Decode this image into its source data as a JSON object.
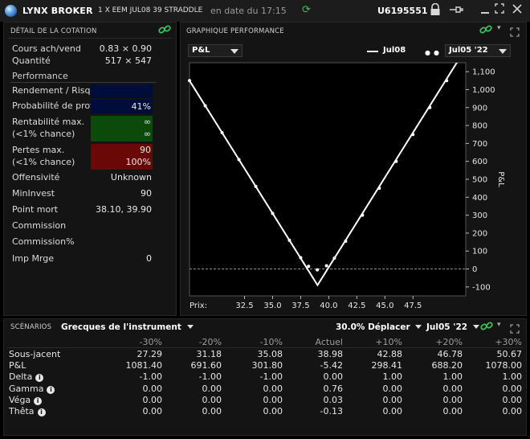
{
  "titlebar": {
    "app_title": "LYNX BROKER",
    "subtitle": "1 X EEM JUL08 39 STRADDLE",
    "date_label": "en date du 17:15",
    "account_id": "U6195551"
  },
  "quote": {
    "title": "DÉTAIL DE LA COTATION",
    "rows": {
      "bidask": {
        "label": "Cours ach/vend",
        "value": "0.83 × 0.90"
      },
      "qty": {
        "label": "Quantité",
        "value": "517 × 547"
      },
      "perf_header": "Performance",
      "rr": {
        "label": "Rendement / Risque",
        "value": ""
      },
      "prob": {
        "label": "Probabilité de profits",
        "value": "41%"
      },
      "maxret": {
        "label1": "Rentabilité max.",
        "label2": "(<1% chance)",
        "value1": "∞",
        "value2": "∞"
      },
      "maxloss": {
        "label1": "Pertes max.",
        "label2": "(<1% chance)",
        "value1": "90",
        "value2": "100%"
      },
      "offens": {
        "label": "Offensivité",
        "value": "Unknown"
      },
      "mininv": {
        "label": "MinInvest",
        "value": "90"
      },
      "breakeven": {
        "label": "Point mort",
        "value": "38.10, 39.90"
      },
      "commission": {
        "label": "Commission",
        "value": ""
      },
      "commissionpct": {
        "label": "Commission%",
        "value": ""
      },
      "impmrge": {
        "label": "Imp Mrge",
        "value": "0"
      }
    }
  },
  "perf_chart": {
    "title": "GRAPHIQUE PERFORMANCE",
    "pl_select": "P&L",
    "legend_solid": "Jul08",
    "legend_dotted": "Jul05 '22",
    "date_select": "Jul05 '22"
  },
  "chart_data": {
    "type": "line",
    "xlabel": "Prix:",
    "ylabel": "P&L",
    "xlim": [
      27.6,
      52.2
    ],
    "ylim": [
      -150,
      1150
    ],
    "x_ticks": [
      "32.5",
      "35.0",
      "37.5",
      "40.0",
      "42.5",
      "45.0",
      "47.5"
    ],
    "y_ticks": [
      "1,100",
      "1,000",
      "900",
      "800",
      "700",
      "600",
      "500",
      "400",
      "300",
      "200",
      "100",
      "0",
      "-100"
    ],
    "series": [
      {
        "name": "Jul08",
        "style": "solid",
        "x": [
          27.6,
          39.0,
          52.2
        ],
        "y": [
          1050,
          -90,
          1230
        ]
      },
      {
        "name": "Jul05 '22",
        "style": "dotted",
        "x": [
          27.6,
          29.0,
          30.5,
          32.0,
          33.5,
          35.0,
          36.5,
          37.5,
          38.2,
          38.98,
          39.8,
          40.5,
          41.5,
          43.0,
          44.5,
          46.0,
          47.5,
          49.0,
          50.5,
          52.2
        ],
        "y": [
          1050,
          910,
          760,
          610,
          460,
          310,
          160,
          63,
          15,
          -5,
          18,
          60,
          155,
          300,
          450,
          600,
          750,
          900,
          1050,
          1220
        ]
      }
    ],
    "zero_line": true,
    "grid": false
  },
  "scenarios": {
    "title": "SCÉNARIOS",
    "greeks_select": "Grecques de l'instrument",
    "shift_select": "30.0% Déplacer",
    "date_select": "Jul05 '22",
    "columns": [
      "-30%",
      "-20%",
      "-10%",
      "Actuel",
      "+10%",
      "+20%",
      "+30%"
    ],
    "rows": [
      {
        "label": "Sous-jacent",
        "info": false,
        "values": [
          "27.29",
          "31.18",
          "35.08",
          "38.98",
          "42.88",
          "46.78",
          "50.67"
        ]
      },
      {
        "label": "P&L",
        "info": false,
        "values": [
          "1081.40",
          "691.60",
          "301.80",
          "-5.42",
          "298.41",
          "688.20",
          "1078.00"
        ]
      },
      {
        "label": "Delta",
        "info": true,
        "values": [
          "-1.00",
          "-1.00",
          "-1.00",
          "0.00",
          "1.00",
          "1.00",
          "1.00"
        ]
      },
      {
        "label": "Gamma",
        "info": true,
        "values": [
          "0.00",
          "0.00",
          "0.00",
          "0.76",
          "0.00",
          "0.00",
          "0.00"
        ]
      },
      {
        "label": "Véga",
        "info": true,
        "values": [
          "0.00",
          "0.00",
          "0.00",
          "0.03",
          "0.00",
          "0.00",
          "0.00"
        ]
      },
      {
        "label": "Thêta",
        "info": true,
        "values": [
          "0.00",
          "0.00",
          "0.00",
          "-0.13",
          "0.00",
          "0.00",
          "0.00"
        ]
      }
    ]
  },
  "colors": {
    "green_box": "#0c4a0c",
    "red_box": "#6a0808",
    "navy_box": "#000c3a",
    "link_green": "#3cbf55"
  }
}
